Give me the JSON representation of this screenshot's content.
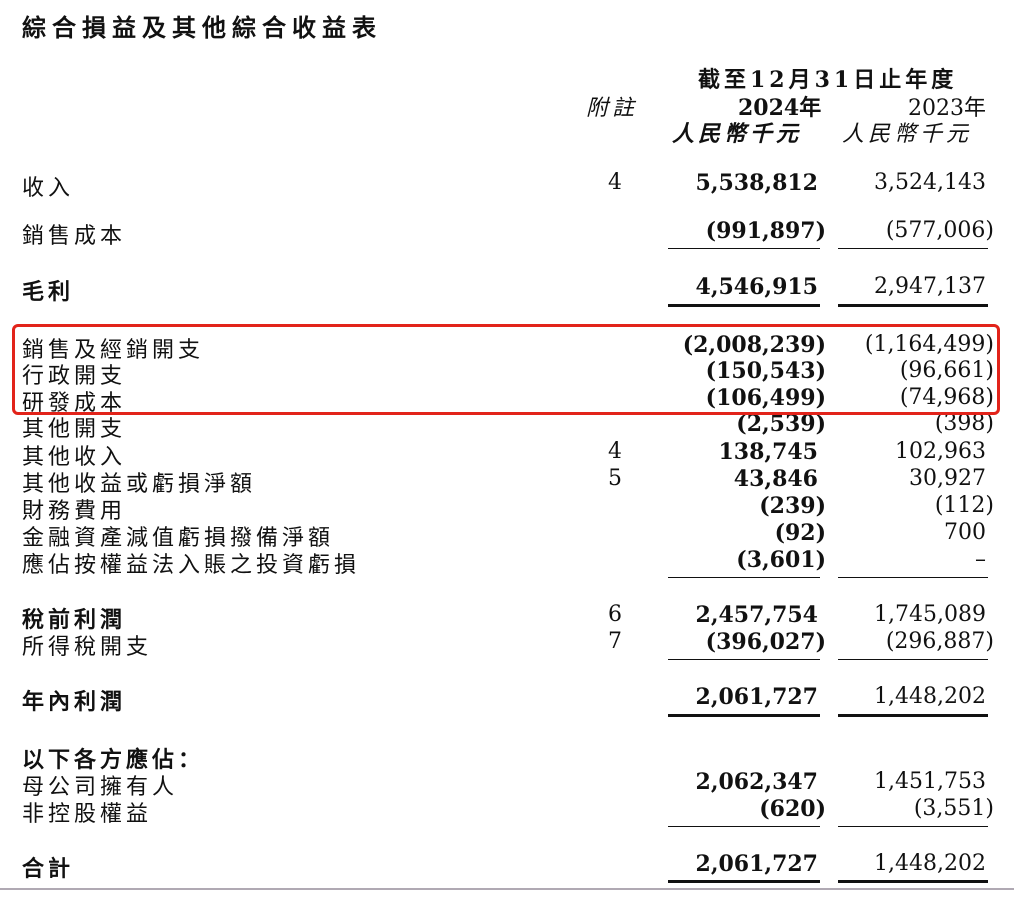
{
  "title": "綜合損益及其他綜合收益表",
  "header": {
    "period": "截至12月31日止年度",
    "note_label": "附註",
    "year_2024": "2024年",
    "year_2023": "2023年",
    "currency_2024": "人民幣千元",
    "currency_2023": "人民幣千元"
  },
  "rows": [
    {
      "label": "收入",
      "note": "4",
      "v2024": "5,538,812",
      "v2023": "3,524,143"
    },
    {
      "label": "銷售成本",
      "note": "",
      "v2024": "(991,897)",
      "v2023": "(577,006)"
    },
    {
      "label": "毛利",
      "note": "",
      "v2024": "4,546,915",
      "v2023": "2,947,137"
    },
    {
      "label": "銷售及經銷開支",
      "note": "",
      "v2024": "(2,008,239)",
      "v2023": "(1,164,499)"
    },
    {
      "label": "行政開支",
      "note": "",
      "v2024": "(150,543)",
      "v2023": "(96,661)"
    },
    {
      "label": "研發成本",
      "note": "",
      "v2024": "(106,499)",
      "v2023": "(74,968)"
    },
    {
      "label": "其他開支",
      "note": "",
      "v2024": "(2,539)",
      "v2023": "(398)"
    },
    {
      "label": "其他收入",
      "note": "4",
      "v2024": "138,745",
      "v2023": "102,963"
    },
    {
      "label": "其他收益或虧損淨額",
      "note": "5",
      "v2024": "43,846",
      "v2023": "30,927"
    },
    {
      "label": "財務費用",
      "note": "",
      "v2024": "(239)",
      "v2023": "(112)"
    },
    {
      "label": "金融資產減值虧損撥備淨額",
      "note": "",
      "v2024": "(92)",
      "v2023": "700"
    },
    {
      "label": "應佔按權益法入賬之投資虧損",
      "note": "",
      "v2024": "(3,601)",
      "v2023": "–"
    },
    {
      "label": "稅前利潤",
      "note": "6",
      "v2024": "2,457,754",
      "v2023": "1,745,089"
    },
    {
      "label": "所得稅開支",
      "note": "7",
      "v2024": "(396,027)",
      "v2023": "(296,887)"
    },
    {
      "label": "年內利潤",
      "note": "",
      "v2024": "2,061,727",
      "v2023": "1,448,202"
    },
    {
      "label": "以下各方應佔：",
      "note": "",
      "v2024": "",
      "v2023": ""
    },
    {
      "label": "母公司擁有人",
      "note": "",
      "v2024": "2,062,347",
      "v2023": "1,451,753"
    },
    {
      "label": "非控股權益",
      "note": "",
      "v2024": "(620)",
      "v2023": "(3,551)"
    },
    {
      "label": "合計",
      "note": "",
      "v2024": "2,061,727",
      "v2023": "1,448,202"
    }
  ],
  "highlight_color": "#e2231a"
}
